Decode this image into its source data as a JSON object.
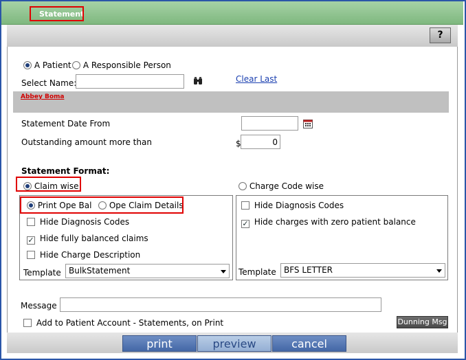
{
  "window": {
    "title": "Statement",
    "help_label": "?"
  },
  "patient_type": {
    "options": [
      "A Patient",
      "A Responsible Person"
    ],
    "selected": "A Patient"
  },
  "select_name": {
    "label": "Select Name:",
    "value": "",
    "clear_last": "Clear Last",
    "selected_name": "Abbey Boma"
  },
  "statement_date": {
    "label": "Statement Date From",
    "value": ""
  },
  "outstanding": {
    "label": "Outstanding amount more than",
    "currency": "$",
    "value": "0"
  },
  "format": {
    "heading": "Statement Format:",
    "claim_wise": "Claim wise",
    "charge_code_wise": "Charge Code wise",
    "selected": "Claim wise"
  },
  "claim_panel": {
    "print_ope_bal": "Print Ope Bal",
    "ope_claim_details": "Ope Claim Details",
    "selected": "Print Ope Bal",
    "hide_diagnosis": {
      "label": "Hide Diagnosis Codes",
      "checked": false
    },
    "hide_balanced": {
      "label": "Hide fully balanced claims",
      "checked": true
    },
    "hide_charge_desc": {
      "label": "Hide Charge Description",
      "checked": false
    },
    "template_label": "Template",
    "template_value": "BulkStatement"
  },
  "charge_panel": {
    "hide_diagnosis": {
      "label": "Hide Diagnosis Codes",
      "checked": false
    },
    "hide_zero_balance": {
      "label": "Hide charges with zero patient balance",
      "checked": true
    },
    "template_label": "Template",
    "template_value": "BFS LETTER"
  },
  "message": {
    "label": "Message",
    "value": ""
  },
  "add_to_account": {
    "label": "Add to Patient Account - Statements, on Print",
    "checked": false
  },
  "dunning_label": "Dunning Msg",
  "buttons": {
    "print": "print",
    "preview": "preview",
    "cancel": "cancel"
  },
  "colors": {
    "title_bar": "#8cc48c",
    "highlight": "#e00000",
    "link": "#1a3fb0",
    "button": "#4f72b0"
  }
}
